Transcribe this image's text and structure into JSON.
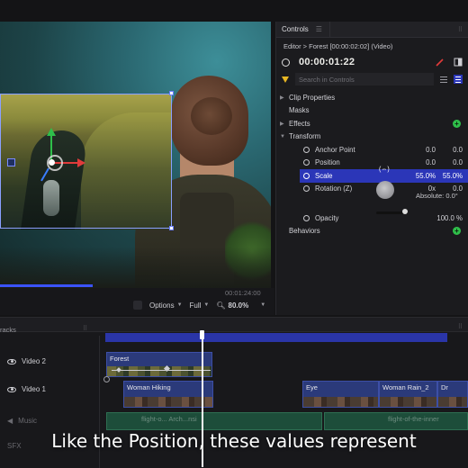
{
  "controls": {
    "tab_label": "Controls",
    "breadcrumb": "Editor > Forest [00:00:02:02] (Video)",
    "timecode": "00:00:01:22",
    "search_placeholder": "Search in Controls",
    "sections": {
      "clip_properties": "Clip Properties",
      "masks": "Masks",
      "effects": "Effects",
      "transform": "Transform",
      "behaviors": "Behaviors"
    },
    "properties": [
      {
        "name": "Anchor Point",
        "v1": "0.0",
        "v2": "0.0"
      },
      {
        "name": "Position",
        "v1": "0.0",
        "v2": "0.0"
      },
      {
        "name": "Scale",
        "v1": "55.0%",
        "v2": "55.0%"
      },
      {
        "name": "Rotation (Z)",
        "v1": "0x",
        "v2": "0.0"
      }
    ],
    "absolute": "Absolute: 0.0°",
    "opacity": {
      "name": "Opacity",
      "value": "100.0 %"
    },
    "accent_color": "#2b36b8"
  },
  "viewer": {
    "timecode_small": "00:01:24:00",
    "options_label": "Options",
    "quality_label": "Full",
    "zoom_label": "80.0%"
  },
  "timeline": {
    "header_label": "racks",
    "tracks": [
      {
        "name": "Video 2"
      },
      {
        "name": "Video 1"
      },
      {
        "name": "Music"
      },
      {
        "name": "SFX"
      }
    ],
    "clips": {
      "forest": "Forest",
      "woman_hiking": "Woman Hiking",
      "eye": "Eye",
      "woman_rain": "Woman Rain_2",
      "dr": "Dr",
      "music_1": "flight-o... Arch...nsi",
      "music_2": "flight-of-the-inner"
    }
  },
  "subtitle": "Like the Position, these values represent"
}
